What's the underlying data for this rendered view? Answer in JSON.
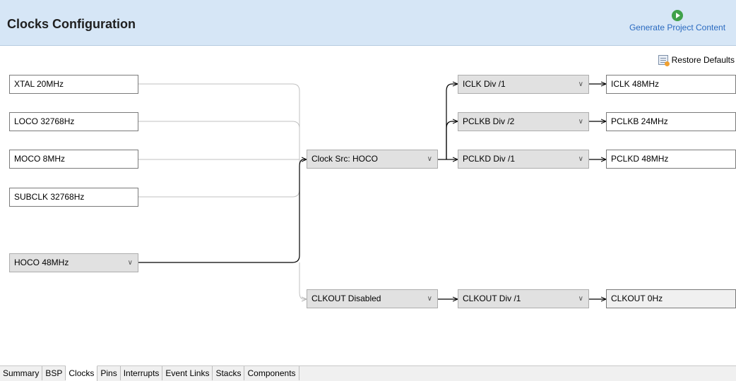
{
  "header": {
    "title": "Clocks Configuration",
    "generate_label": "Generate Project Content"
  },
  "toolbar": {
    "restore_label": "Restore Defaults"
  },
  "sources": {
    "xtal": "XTAL 20MHz",
    "loco": "LOCO 32768Hz",
    "moco": "MOCO 8MHz",
    "subclk": "SUBCLK 32768Hz",
    "hoco": "HOCO 48MHz"
  },
  "clock_src": {
    "value": "Clock Src: HOCO"
  },
  "dividers": {
    "iclk": "ICLK Div /1",
    "pclkb": "PCLKB Div /2",
    "pclkd": "PCLKD Div /1"
  },
  "outputs": {
    "iclk": "ICLK 48MHz",
    "pclkb": "PCLKB 24MHz",
    "pclkd": "PCLKD 48MHz"
  },
  "clkout": {
    "source": "CLKOUT Disabled",
    "div": "CLKOUT Div /1",
    "value": "CLKOUT 0Hz"
  },
  "tabs": [
    "Summary",
    "BSP",
    "Clocks",
    "Pins",
    "Interrupts",
    "Event Links",
    "Stacks",
    "Components"
  ],
  "active_tab": "Clocks",
  "colors": {
    "header_bg": "#d6e6f6",
    "link": "#2a6ac0",
    "active_wire": "#000000",
    "inactive_wire": "#c0c0c0"
  }
}
